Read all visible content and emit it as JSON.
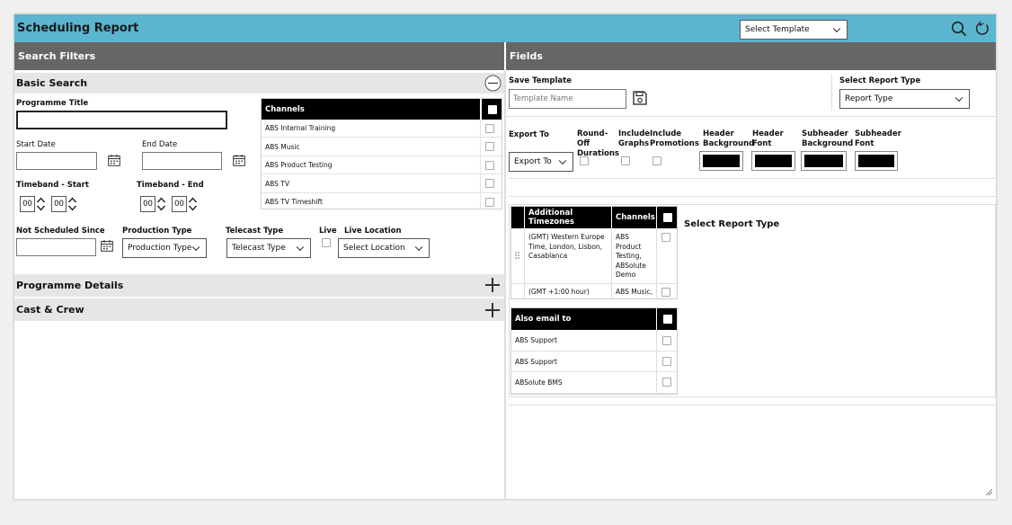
{
  "app": {
    "title": "Scheduling Report",
    "template_select": "Select Template"
  },
  "left": {
    "header": "Search Filters",
    "basic_search": "Basic Search",
    "programme_title_label": "Programme Title",
    "start_date_label": "Start Date",
    "end_date_label": "End Date",
    "timeband_start_label": "Timeband - Start",
    "timeband_end_label": "Timeband - End",
    "timeband_start": {
      "h": "00",
      "m": "00"
    },
    "timeband_end": {
      "h": "00",
      "m": "00"
    },
    "channels_header": "Channels",
    "channels": [
      "ABS Internal Training",
      "ABS Music",
      "ABS Product Testing",
      "ABS TV",
      "ABS TV Timeshift"
    ],
    "not_scheduled_label": "Not Scheduled Since",
    "production_type_label": "Production Type",
    "production_type_value": "Production Type",
    "telecast_type_label": "Telecast Type",
    "telecast_type_value": "Telecast Type",
    "live_label": "Live",
    "live_location_label": "Live Location",
    "live_location_value": "Select Location",
    "programme_details": "Programme Details",
    "cast_crew": "Cast & Crew"
  },
  "right": {
    "header": "Fields",
    "save_template_label": "Save Template",
    "template_name_placeholder": "Template Name",
    "select_report_type_label": "Select Report Type",
    "report_type_value": "Report Type",
    "export_to_label": "Export To",
    "export_to_value": "Export To",
    "round_off": "Round-Off Durations",
    "include_graphs": "Include Graphs",
    "include_promotions": "Include Promotions",
    "header_background": "Header Background",
    "header_font": "Header Font",
    "subheader_background": "Subheader Background",
    "subheader_font": "Subheader Font",
    "tz_table": {
      "col1": "Additional Timezones",
      "col2": "Channels",
      "rows": [
        {
          "tz": "(GMT) Western Europe Time, London, Lisbon, Casablanca",
          "channels": "ABS Product Testing, ABSolute Demo"
        },
        {
          "tz": "(GMT +1:00 hour)",
          "channels": "ABS Music,"
        }
      ]
    },
    "select_report_type_msg": "Select Report Type",
    "email_table": {
      "header": "Also email to",
      "rows": [
        "ABS Support",
        "ABS Support",
        "ABSolute BMS"
      ]
    }
  },
  "colors": {
    "topbar": "#5bb5cf",
    "section_bar": "#666666",
    "accent_black": "#000000"
  }
}
